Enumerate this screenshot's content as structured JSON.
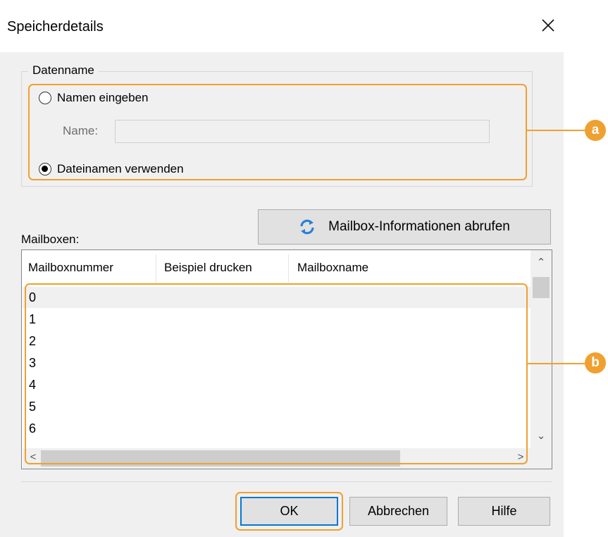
{
  "dialog": {
    "title": "Speicherdetails"
  },
  "filename_group": {
    "legend": "Datenname",
    "option_enter_name": "Namen eingeben",
    "name_label": "Name:",
    "name_value": "",
    "option_use_filename": "Dateinamen verwenden",
    "selected": "Dateinamen verwenden"
  },
  "fetch_button": {
    "label": "Mailbox-Informationen abrufen",
    "icon": "refresh-icon"
  },
  "mailboxes": {
    "label": "Mailboxen:",
    "columns": [
      "Mailboxnummer",
      "Beispiel drucken",
      "Mailboxname"
    ],
    "rows": [
      "0",
      "1",
      "2",
      "3",
      "4",
      "5",
      "6"
    ]
  },
  "buttons": {
    "ok": "OK",
    "cancel": "Abbrechen",
    "help": "Hilfe"
  },
  "callouts": {
    "a": "a",
    "b": "b"
  },
  "colors": {
    "callout": "#f0a030",
    "focus": "#0078d7"
  }
}
